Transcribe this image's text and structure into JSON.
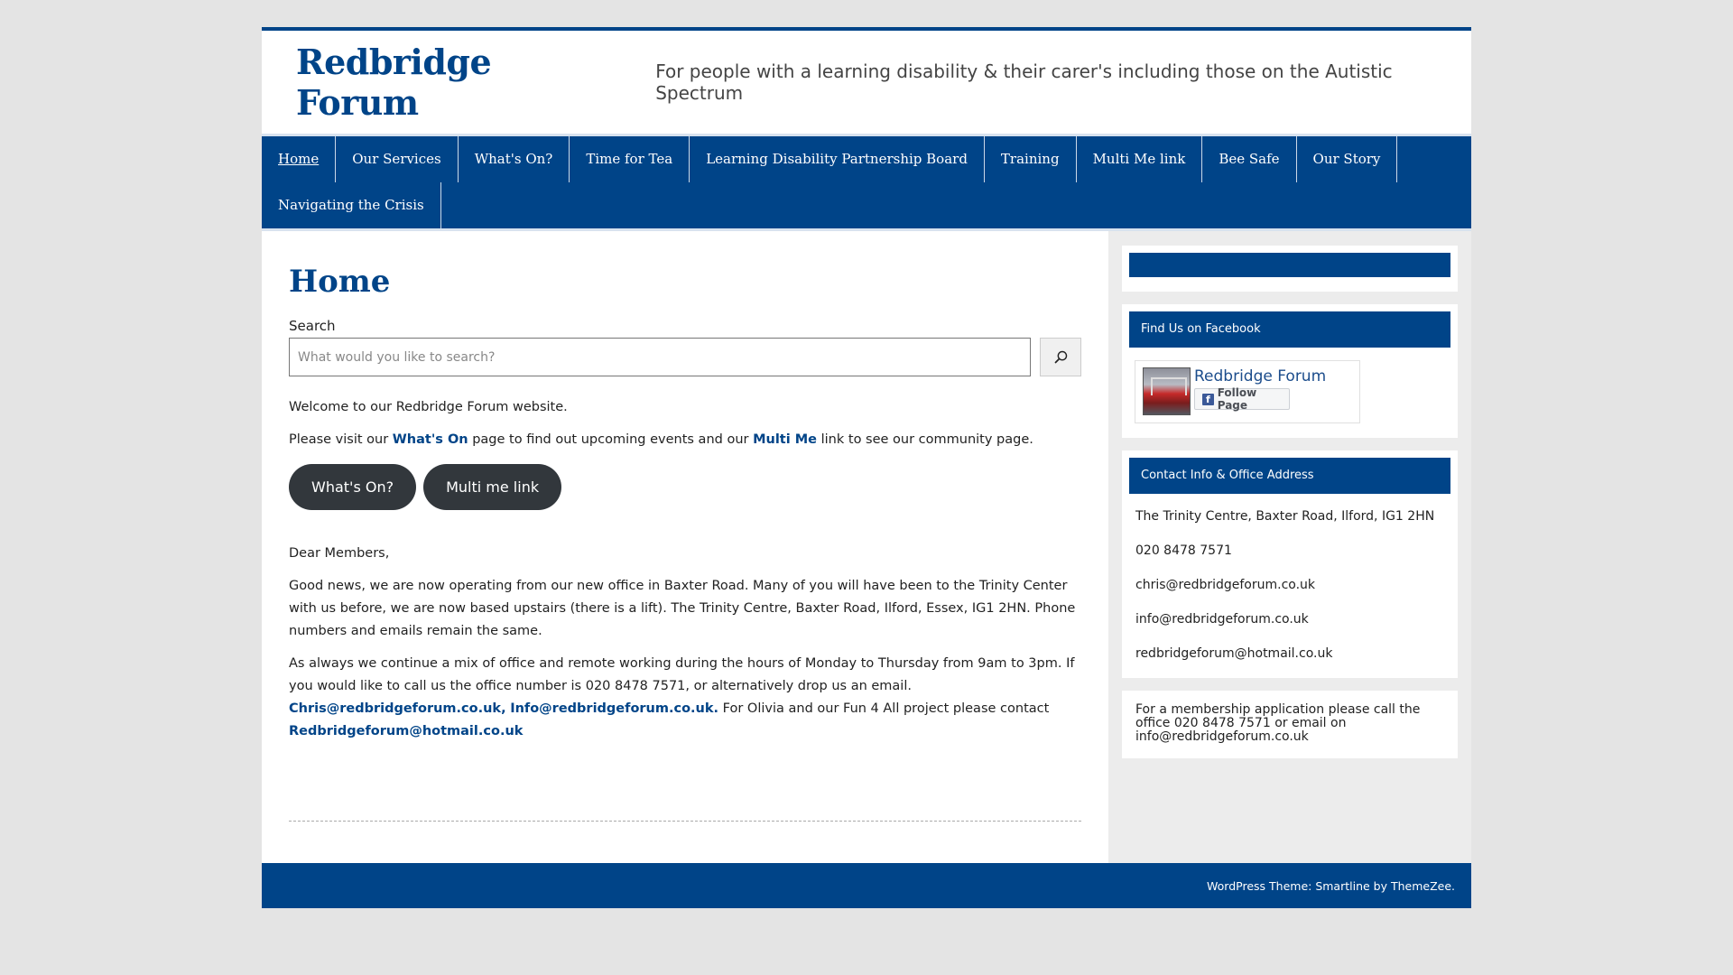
{
  "header": {
    "site_title": "Redbridge Forum",
    "tagline": "For people with a learning disability & their carer's including those on the Autistic Spectrum"
  },
  "nav": {
    "items": [
      {
        "label": "Home"
      },
      {
        "label": "Our Services"
      },
      {
        "label": "What's On?"
      },
      {
        "label": "Time for Tea"
      },
      {
        "label": "Learning Disability Partnership Board"
      },
      {
        "label": "Training"
      },
      {
        "label": "Multi Me link"
      },
      {
        "label": "Bee Safe"
      },
      {
        "label": "Our Story"
      },
      {
        "label": "Navigating the Crisis"
      }
    ],
    "active": "Home"
  },
  "main": {
    "page_title": "Home",
    "search": {
      "label": "Search",
      "placeholder": "What would you like to search?",
      "value": ""
    },
    "welcome": "Welcome to our Redbridge Forum website.",
    "visit": {
      "pre": "Please visit our ",
      "link1": "What's On",
      "mid": " page to find out upcoming events and our ",
      "link2": "Multi Me",
      "post": " link to see our community page."
    },
    "buttons": {
      "whats_on": "What's On?",
      "multi_me": "Multi me link"
    },
    "dear": "Dear Members,",
    "news": "Good news, we are now operating from our new office in Baxter Road.  Many of you will have been to the Trinity Center with us before, we are now based upstairs (there is a lift).  The Trinity Centre, Baxter Road, Ilford, Essex, IG1 2HN.  Phone numbers and emails remain the same.",
    "always": {
      "pre": "As always we continue a mix of office and remote working during the hours of Monday to Thursday from 9am to 3pm. If you would like to call us the office number is 020 8478 7571, or alternatively drop us an email.  ",
      "email1": "Chris@redbridgeforum.co.uk,",
      "gap": " ",
      "email2": "Info@redbridgeforum.co.uk.",
      "mid": "  For Olivia and our Fun 4 All project please contact ",
      "email3": "Redbridgeforum@hotmail.co.uk"
    }
  },
  "sidebar": {
    "facebook": {
      "title": "Find Us on Facebook",
      "page_name": "Redbridge Forum",
      "follow_label": "Follow Page",
      "logo_letter": "f"
    },
    "contact": {
      "title": "Contact Info & Office Address",
      "lines": [
        "The Trinity Centre, Baxter Road, Ilford, IG1 2HN",
        "020 8478 7571",
        "chris@redbridgeforum.co.uk",
        "info@redbridgeforum.co.uk",
        "redbridgeforum@hotmail.co.uk"
      ]
    },
    "membership": "For a membership application please call the office 020 8478 7571 or email on info@redbridgeforum.co.uk"
  },
  "footer": {
    "credit": "WordPress Theme: Smartline by ThemeZee."
  },
  "colors": {
    "brand_blue": "#004488",
    "button_dark": "#32373c",
    "page_bg": "#e4e4e4",
    "facebook_blue": "#3b5998"
  }
}
